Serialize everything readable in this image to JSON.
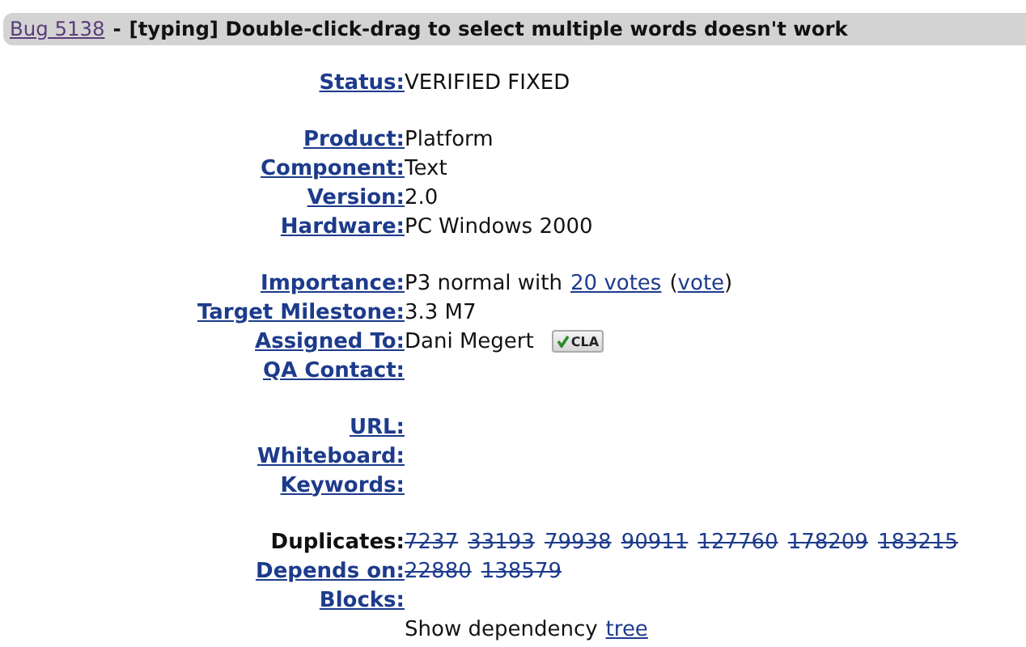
{
  "header": {
    "bug_link": "Bug 5138",
    "separator": "-",
    "summary": "[typing] Double-click-drag to select multiple words doesn't work"
  },
  "sections": [
    {
      "fields": [
        {
          "label": "Status:",
          "label_link": true,
          "value": [
            {
              "kind": "text",
              "text": "VERIFIED FIXED"
            }
          ]
        }
      ]
    },
    {
      "fields": [
        {
          "label": "Product:",
          "label_link": true,
          "value": [
            {
              "kind": "text",
              "text": "Platform"
            }
          ]
        },
        {
          "label": "Component:",
          "label_link": true,
          "value": [
            {
              "kind": "text",
              "text": "Text"
            }
          ]
        },
        {
          "label": "Version:",
          "label_link": true,
          "value": [
            {
              "kind": "text",
              "text": "2.0"
            }
          ]
        },
        {
          "label": "Hardware:",
          "label_link": true,
          "value": [
            {
              "kind": "text",
              "text": "PC Windows 2000"
            }
          ]
        }
      ]
    },
    {
      "fields": [
        {
          "label": "Importance:",
          "label_link": true,
          "value": [
            {
              "kind": "text",
              "text": "P3 normal with"
            },
            {
              "kind": "link",
              "text": "20 votes"
            },
            {
              "kind": "paren_link",
              "open": "(",
              "text": "vote",
              "close": ")"
            }
          ]
        },
        {
          "label": "Target Milestone:",
          "label_link": true,
          "value": [
            {
              "kind": "text",
              "text": "3.3 M7"
            }
          ]
        },
        {
          "label": "Assigned To:",
          "label_link": true,
          "value": [
            {
              "kind": "text",
              "text": "Dani Megert"
            },
            {
              "kind": "badge",
              "text": "CLA"
            }
          ]
        },
        {
          "label": "QA Contact:",
          "label_link": true
        }
      ]
    },
    {
      "fields": [
        {
          "label": "URL:",
          "label_link": true
        },
        {
          "label": "Whiteboard:",
          "label_link": true
        },
        {
          "label": "Keywords:",
          "label_link": true
        }
      ]
    },
    {
      "fields": [
        {
          "label": "Duplicates:",
          "label_link": false,
          "value": [
            {
              "kind": "closed",
              "text": "7237"
            },
            {
              "kind": "closed",
              "text": "33193"
            },
            {
              "kind": "closed",
              "text": "79938"
            },
            {
              "kind": "closed",
              "text": "90911"
            },
            {
              "kind": "closed",
              "text": "127760"
            },
            {
              "kind": "closed",
              "text": "178209"
            },
            {
              "kind": "closed",
              "text": "183215"
            }
          ]
        },
        {
          "label": "Depends on:",
          "label_link": true,
          "value": [
            {
              "kind": "closed",
              "text": "22880"
            },
            {
              "kind": "closed",
              "text": "138579"
            }
          ]
        },
        {
          "label": "Blocks:",
          "label_link": true
        }
      ]
    }
  ],
  "dependency": {
    "text": "Show dependency",
    "link": "tree"
  }
}
